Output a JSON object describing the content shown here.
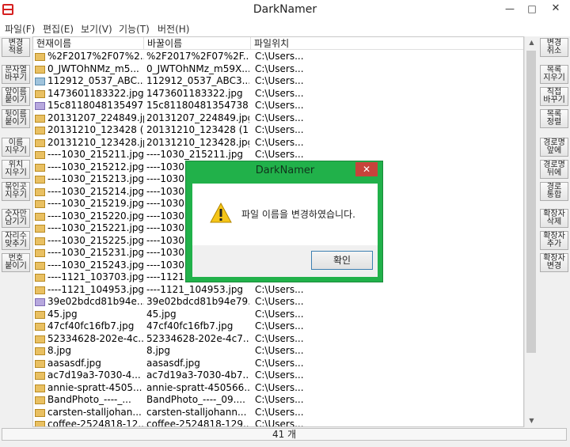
{
  "window": {
    "title": "DarkNamer"
  },
  "menu": [
    "파일(F)",
    "편집(E)",
    "보기(V)",
    "기능(T)",
    "버전(H)"
  ],
  "left_buttons": [
    "변경\n적용",
    "문자열\n바꾸기",
    "앞이름\n붙이기",
    "뒷이름\n붙이기",
    "이름\n지우기",
    "위치\n지우기",
    "묶인곳\n지우기",
    "숫자만\n남기기",
    "자리수\n맞추기",
    "번호\n붙이기"
  ],
  "right_buttons": [
    "변경\n취소",
    "목록\n지우기",
    "직접\n바꾸기",
    "목록\n정렬",
    "경로명\n앞에",
    "경로명\n뒤에",
    "경로\n통합",
    "확장자\n삭제",
    "확장자\n추가",
    "확장자\n변경"
  ],
  "list": {
    "headers": {
      "current": "현재이름",
      "new": "바꿀이름",
      "location": "파일위치"
    },
    "rows": [
      {
        "icon": "jpg",
        "current": "%2F2017%2F07%2...",
        "new": "%2F2017%2F07%2F...",
        "location": "C:\\Users..."
      },
      {
        "icon": "jpg",
        "current": "0_JWTOhNMz_m5...",
        "new": "0_JWTOhNMz_m59X...",
        "location": "C:\\Users..."
      },
      {
        "icon": "png",
        "current": "112912_0537_ABC...",
        "new": "112912_0537_ABC3....",
        "location": "C:\\Users..."
      },
      {
        "icon": "jpg",
        "current": "1473601183322.jpg",
        "new": "1473601183322.jpg",
        "location": "C:\\Users..."
      },
      {
        "icon": "gif",
        "current": "15c81180481354973...",
        "new": "15c81180481354738.gif",
        "location": "C:\\Users..."
      },
      {
        "icon": "jpg",
        "current": "20131207_224849.jpg",
        "new": "20131207_224849.jpg",
        "location": "C:\\Users..."
      },
      {
        "icon": "jpg",
        "current": "20131210_123428 (...",
        "new": "20131210_123428 (1)....",
        "location": "C:\\Users..."
      },
      {
        "icon": "jpg",
        "current": "20131210_123428.jpg",
        "new": "20131210_123428.jpg",
        "location": "C:\\Users..."
      },
      {
        "icon": "jpg",
        "current": "----1030_215211.jpg",
        "new": "----1030_215211.jpg",
        "location": "C:\\Users..."
      },
      {
        "icon": "jpg",
        "current": "----1030_215212.jpg",
        "new": "----1030",
        "location": ""
      },
      {
        "icon": "jpg",
        "current": "----1030_215213.jpg",
        "new": "----1030",
        "location": ""
      },
      {
        "icon": "jpg",
        "current": "----1030_215214.jpg",
        "new": "----1030",
        "location": ""
      },
      {
        "icon": "jpg",
        "current": "----1030_215219.jpg",
        "new": "----1030",
        "location": ""
      },
      {
        "icon": "jpg",
        "current": "----1030_215220.jpg",
        "new": "----1030",
        "location": ""
      },
      {
        "icon": "jpg",
        "current": "----1030_215221.jpg",
        "new": "----1030",
        "location": ""
      },
      {
        "icon": "jpg",
        "current": "----1030_215225.jpg",
        "new": "----1030",
        "location": ""
      },
      {
        "icon": "jpg",
        "current": "----1030_215231.jpg",
        "new": "----1030",
        "location": ""
      },
      {
        "icon": "jpg",
        "current": "----1030_215243.jpg",
        "new": "----1030",
        "location": ""
      },
      {
        "icon": "jpg",
        "current": "----1121_103703.jpg",
        "new": "----1121",
        "location": ""
      },
      {
        "icon": "jpg",
        "current": "----1121_104953.jpg",
        "new": "----1121_104953.jpg",
        "location": "C:\\Users..."
      },
      {
        "icon": "gif",
        "current": "39e02bdcd81b94e...",
        "new": "39e02bdcd81b94e79....",
        "location": "C:\\Users..."
      },
      {
        "icon": "jpg",
        "current": "45.jpg",
        "new": "45.jpg",
        "location": "C:\\Users..."
      },
      {
        "icon": "jpg",
        "current": "47cf40fc16fb7.jpg",
        "new": "47cf40fc16fb7.jpg",
        "location": "C:\\Users..."
      },
      {
        "icon": "jpg",
        "current": "52334628-202e-4c...",
        "new": "52334628-202e-4c7...",
        "location": "C:\\Users..."
      },
      {
        "icon": "jpg",
        "current": "8.jpg",
        "new": "8.jpg",
        "location": "C:\\Users..."
      },
      {
        "icon": "jpg",
        "current": "aasasdf.jpg",
        "new": "aasasdf.jpg",
        "location": "C:\\Users..."
      },
      {
        "icon": "jpg",
        "current": "ac7d19a3-7030-4...",
        "new": "ac7d19a3-7030-4b7...",
        "location": "C:\\Users..."
      },
      {
        "icon": "jpg",
        "current": "annie-spratt-4505...",
        "new": "annie-spratt-450566...",
        "location": "C:\\Users..."
      },
      {
        "icon": "jpg",
        "current": "BandPhoto_----_...",
        "new": "BandPhoto_----_09....",
        "location": "C:\\Users..."
      },
      {
        "icon": "jpg",
        "current": "carsten-stalljohan...",
        "new": "carsten-stalljohann...",
        "location": "C:\\Users..."
      },
      {
        "icon": "jpg",
        "current": "coffee-2524818-12...",
        "new": "coffee-2524818-129...",
        "location": "C:\\Users..."
      }
    ]
  },
  "status": {
    "count": "41 개"
  },
  "dialog": {
    "title": "DarkNamer",
    "message": "파일 이름을 변경하였습니다.",
    "ok_label": "확인",
    "close_glyph": "✕"
  },
  "icons": {
    "app": "darknamer-app-icon",
    "warning": "warning-icon",
    "file": "image-file-icon"
  },
  "colors": {
    "dialog_frame": "#21b14a",
    "dialog_close": "#c7433b",
    "app_icon": "#d62020"
  }
}
